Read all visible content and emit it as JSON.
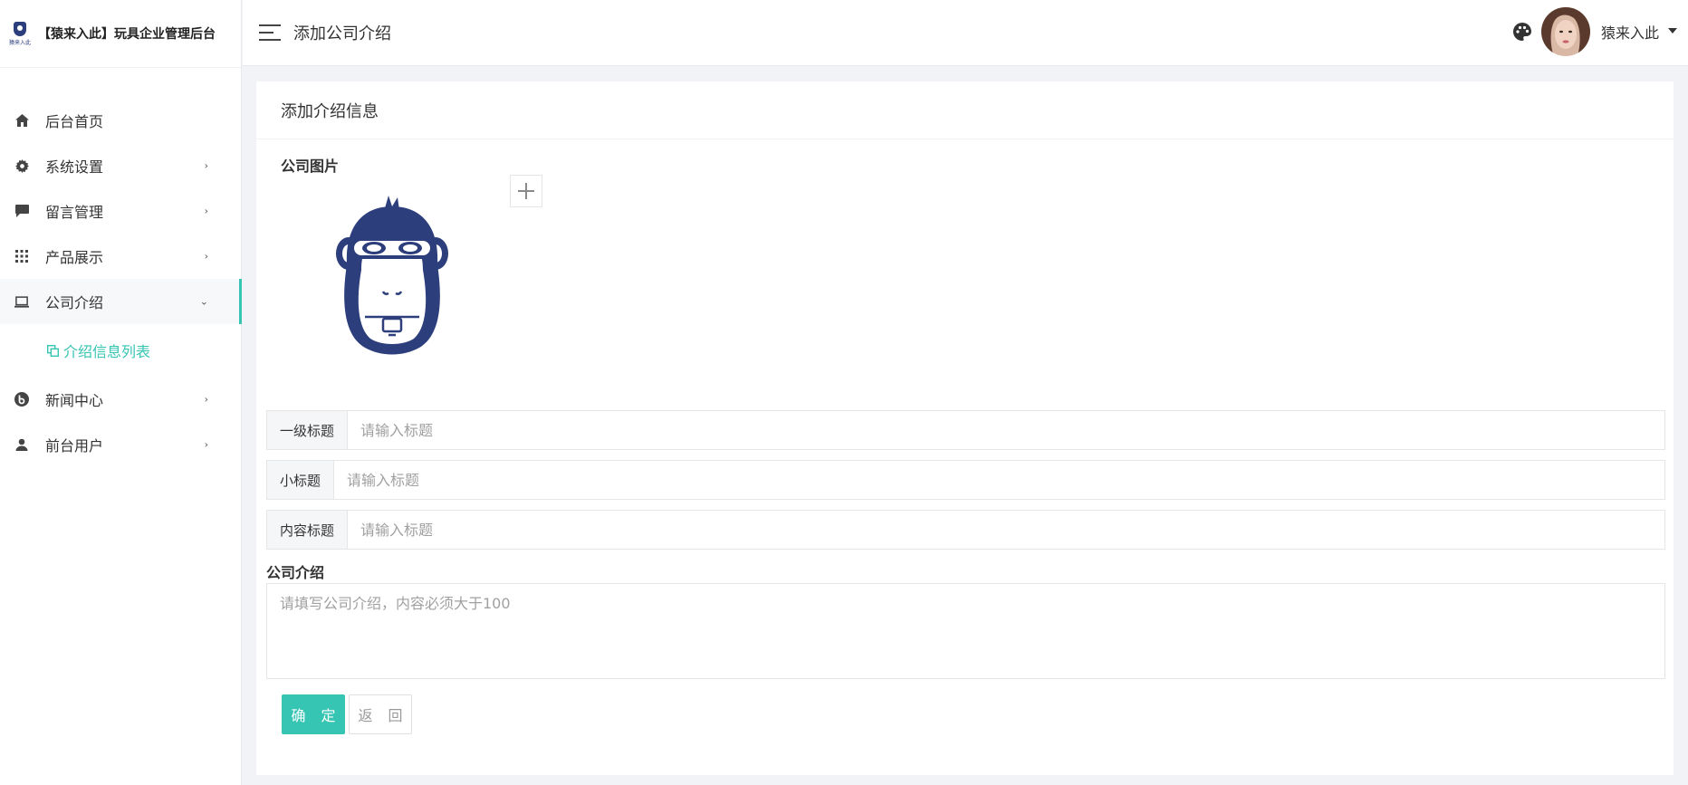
{
  "brand": {
    "logo_text": "猿来入此",
    "title": "【猿来入此】玩具企业管理后台"
  },
  "sidebar": {
    "items": [
      {
        "label": "后台首页",
        "icon": "home-icon"
      },
      {
        "label": "系统设置",
        "icon": "gear-icon"
      },
      {
        "label": "留言管理",
        "icon": "comment-icon"
      },
      {
        "label": "产品展示",
        "icon": "grid-icon"
      },
      {
        "label": "公司介绍",
        "icon": "laptop-icon",
        "active": true
      },
      {
        "label": "新闻中心",
        "icon": "news-icon"
      },
      {
        "label": "前台用户",
        "icon": "user-icon"
      }
    ],
    "submenu": {
      "label": "介绍信息列表",
      "icon": "copy-icon"
    }
  },
  "header": {
    "page_title": "添加公司介绍",
    "user_name": "猿来入此"
  },
  "form": {
    "panel_title": "添加介绍信息",
    "image_label": "公司图片",
    "fields": [
      {
        "label": "一级标题",
        "placeholder": "请输入标题"
      },
      {
        "label": "小标题",
        "placeholder": "请输入标题"
      },
      {
        "label": "内容标题",
        "placeholder": "请输入标题"
      }
    ],
    "intro_label": "公司介绍",
    "intro_placeholder": "请填写公司介绍，内容必须大于100",
    "ok_label": "确 定",
    "back_label": "返 回"
  },
  "colors": {
    "accent": "#36c4b3",
    "logo_navy": "#2c3e7b"
  }
}
